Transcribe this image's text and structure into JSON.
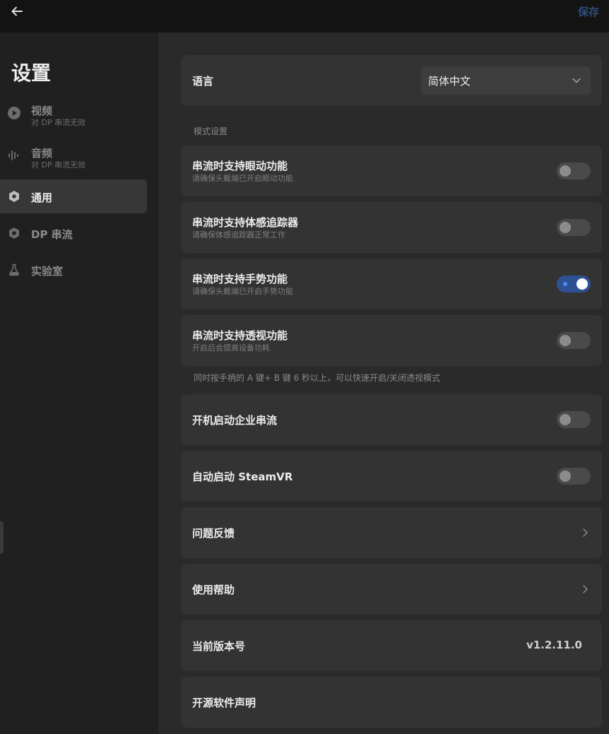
{
  "topbar": {
    "back_icon": "arrow-left-icon",
    "save_label": "保存",
    "save_color": "#2e4d78"
  },
  "sidebar": {
    "title": "设置",
    "items": [
      {
        "label": "视频",
        "sub": "对 DP 串流无效",
        "icon": "play-circle-icon",
        "active": false
      },
      {
        "label": "音频",
        "sub": "对 DP 串流无效",
        "icon": "audio-wave-icon",
        "active": false
      },
      {
        "label": "通用",
        "sub": "",
        "icon": "gear-hex-icon",
        "active": true
      },
      {
        "label": "DP 串流",
        "sub": "",
        "icon": "gear-hex-icon",
        "active": false
      },
      {
        "label": "实验室",
        "sub": "",
        "icon": "flask-icon",
        "active": false
      }
    ]
  },
  "main": {
    "language": {
      "label": "语言",
      "value": "简体中文",
      "icon": "chevron-down-icon"
    },
    "mode_section_label": "模式设置",
    "mode_items": [
      {
        "title": "串流时支持眼动功能",
        "sub": "请确保头戴端已开启眼动功能",
        "enabled": false
      },
      {
        "title": "串流时支持体感追踪器",
        "sub": "请确保体感追踪器正常工作",
        "enabled": false
      },
      {
        "title": "串流时支持手势功能",
        "sub": "请确保头戴端已开启手势功能",
        "enabled": true
      },
      {
        "title": "串流时支持透视功能",
        "sub": "开启后会提高设备功耗",
        "enabled": false
      }
    ],
    "passthrough_hint": "同时按手柄的 A 键+ B 键 6 秒以上，可以快速开启/关闭透视模式",
    "startup_enterprise": {
      "title": "开机启动企业串流",
      "enabled": false
    },
    "auto_steamvr": {
      "title": "自动启动 SteamVR",
      "enabled": false
    },
    "feedback": {
      "title": "问题反馈",
      "icon": "chevron-right-icon"
    },
    "help": {
      "title": "使用帮助",
      "icon": "chevron-right-icon"
    },
    "version": {
      "title": "当前版本号",
      "value": "v1.2.11.0"
    },
    "open_source": {
      "title": "开源软件声明"
    }
  },
  "colors": {
    "accent_toggle_on": "#2d5193",
    "accent_dot": "#4d8ef5",
    "card_bg": "#333333",
    "sidebar_bg": "#202020"
  }
}
